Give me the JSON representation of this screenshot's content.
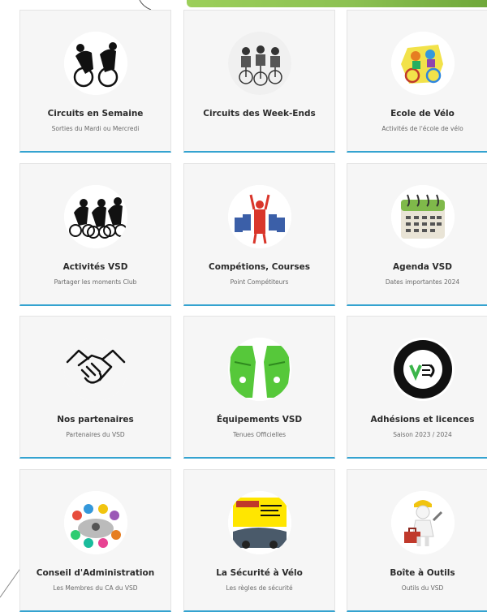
{
  "cards": [
    {
      "title": "Circuits en Semaine",
      "subtitle": "Sorties du Mardi ou Mercredi",
      "icon": "cyclists-silhouette-icon"
    },
    {
      "title": "Circuits des Week-Ends",
      "subtitle": "",
      "icon": "peloton-sketch-icon"
    },
    {
      "title": "Ecole de Vélo",
      "subtitle": "Activités de l'école de vélo",
      "icon": "kids-bmx-icon"
    },
    {
      "title": "Activités VSD",
      "subtitle": "Partager les moments Club",
      "icon": "three-cyclists-icon"
    },
    {
      "title": "Compétions, Courses",
      "subtitle": "Point Compétiteurs",
      "icon": "race-winner-icon"
    },
    {
      "title": "Agenda VSD",
      "subtitle": "Dates importantes 2024",
      "icon": "calendar-icon"
    },
    {
      "title": "Nos partenaires",
      "subtitle": "Partenaires du VSD",
      "icon": "handshake-icon"
    },
    {
      "title": "Équipements VSD",
      "subtitle": "Tenues Officielles",
      "icon": "jersey-icon"
    },
    {
      "title": "Adhésions et licences",
      "subtitle": "Saison 2023 / 2024",
      "icon": "club-logo-icon"
    },
    {
      "title": "Conseil d'Administration",
      "subtitle": "Les Membres du CA du VSD",
      "icon": "meeting-table-icon"
    },
    {
      "title": "La Sécurité à Vélo",
      "subtitle": "Les règles de sécurité",
      "icon": "road-safety-icon"
    },
    {
      "title": "Boîte à Outils",
      "subtitle": "Outils du VSD",
      "icon": "toolbox-worker-icon"
    }
  ]
}
